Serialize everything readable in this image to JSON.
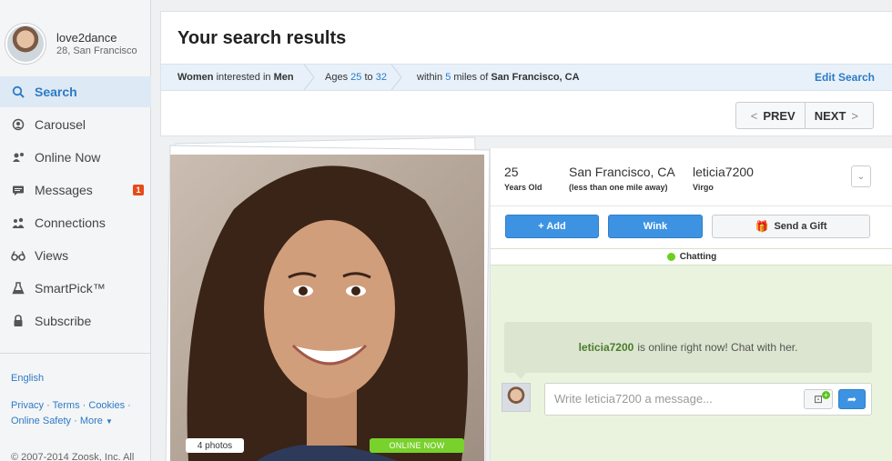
{
  "user": {
    "name": "love2dance",
    "subtitle": "28, San Francisco"
  },
  "sidebar": {
    "items": [
      {
        "label": "Search",
        "icon": "search-icon",
        "glyph": "⚲"
      },
      {
        "label": "Carousel",
        "icon": "carousel-icon",
        "glyph": "◎"
      },
      {
        "label": "Online Now",
        "icon": "online-now-icon",
        "glyph": "●"
      },
      {
        "label": "Messages",
        "icon": "messages-icon",
        "glyph": "▬",
        "badge": "1"
      },
      {
        "label": "Connections",
        "icon": "connections-icon",
        "glyph": "♣"
      },
      {
        "label": "Views",
        "icon": "views-icon",
        "glyph": "∞"
      },
      {
        "label": "SmartPick™",
        "icon": "smartpick-icon",
        "glyph": "△"
      },
      {
        "label": "Subscribe",
        "icon": "lock-icon",
        "glyph": "▲"
      }
    ],
    "language": "English",
    "links": {
      "privacy": "Privacy",
      "terms": "Terms",
      "cookies": "Cookies",
      "safety": "Online Safety",
      "more": "More"
    },
    "copyright": "© 2007-2014 Zoosk, Inc. All"
  },
  "header": {
    "title": "Your search results",
    "criteria": {
      "women": "Women",
      "interested_in": "interested in",
      "men": "Men",
      "ages_label": "Ages",
      "age_from": "25",
      "to": "to",
      "age_to": "32",
      "within": "within",
      "miles": "5",
      "miles_of": "miles of",
      "location": "San Francisco, CA"
    },
    "edit_search": "Edit Search",
    "prev": "PREV",
    "next": "NEXT"
  },
  "profile_card": {
    "photo_count": "4 photos",
    "online_badge": "ONLINE NOW",
    "age": "25",
    "age_sub": "Years Old",
    "city": "San Francisco, CA",
    "city_sub": "(less than one mile away)",
    "username": "leticia7200",
    "sign": "Virgo",
    "actions": {
      "add": "+ Add",
      "wink": "Wink",
      "gift": "Send a Gift"
    },
    "status": "Chatting",
    "chat_prompt_name": "leticia7200",
    "chat_prompt_text": "is online right now! Chat with her.",
    "message_placeholder": "Write leticia7200 a message..."
  },
  "colors": {
    "accent": "#2c7bc6",
    "button_blue": "#3d93e2",
    "online_green": "#79d12c",
    "badge_red": "#e64a19",
    "chat_bg": "#eaf3de"
  }
}
